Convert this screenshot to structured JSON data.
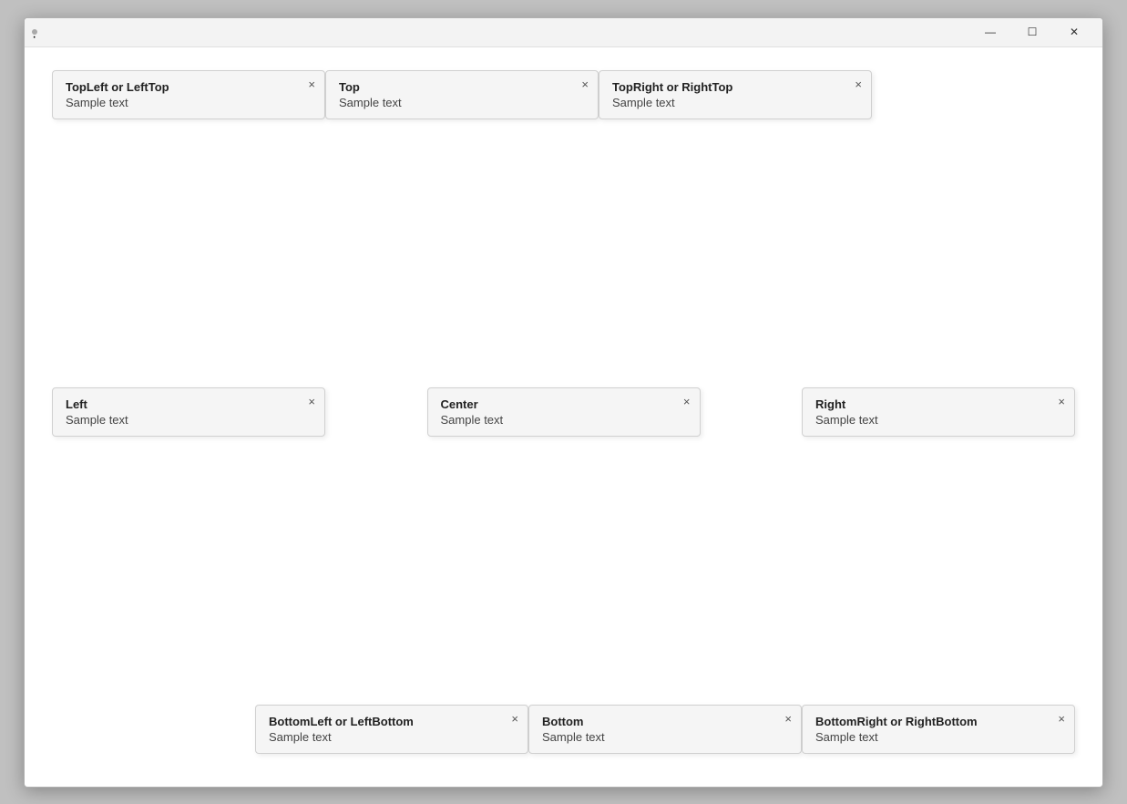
{
  "window": {
    "title_dot": "·"
  },
  "titlebar": {
    "minimize": "—",
    "maximize": "☐",
    "close": "✕"
  },
  "cards": {
    "topleft": {
      "title": "TopLeft or LeftTop",
      "text": "Sample text",
      "close": "×"
    },
    "top": {
      "title": "Top",
      "text": "Sample text",
      "close": "×"
    },
    "topright": {
      "title": "TopRight or RightTop",
      "text": "Sample text",
      "close": "×"
    },
    "left": {
      "title": "Left",
      "text": "Sample text",
      "close": "×"
    },
    "center": {
      "title": "Center",
      "text": "Sample text",
      "close": "×"
    },
    "right": {
      "title": "Right",
      "text": "Sample text",
      "close": "×"
    },
    "bottomleft": {
      "title": "BottomLeft or LeftBottom",
      "text": "Sample text",
      "close": "×"
    },
    "bottom": {
      "title": "Bottom",
      "text": "Sample text",
      "close": "×"
    },
    "bottomright": {
      "title": "BottomRight or RightBottom",
      "text": "Sample text",
      "close": "×"
    }
  }
}
